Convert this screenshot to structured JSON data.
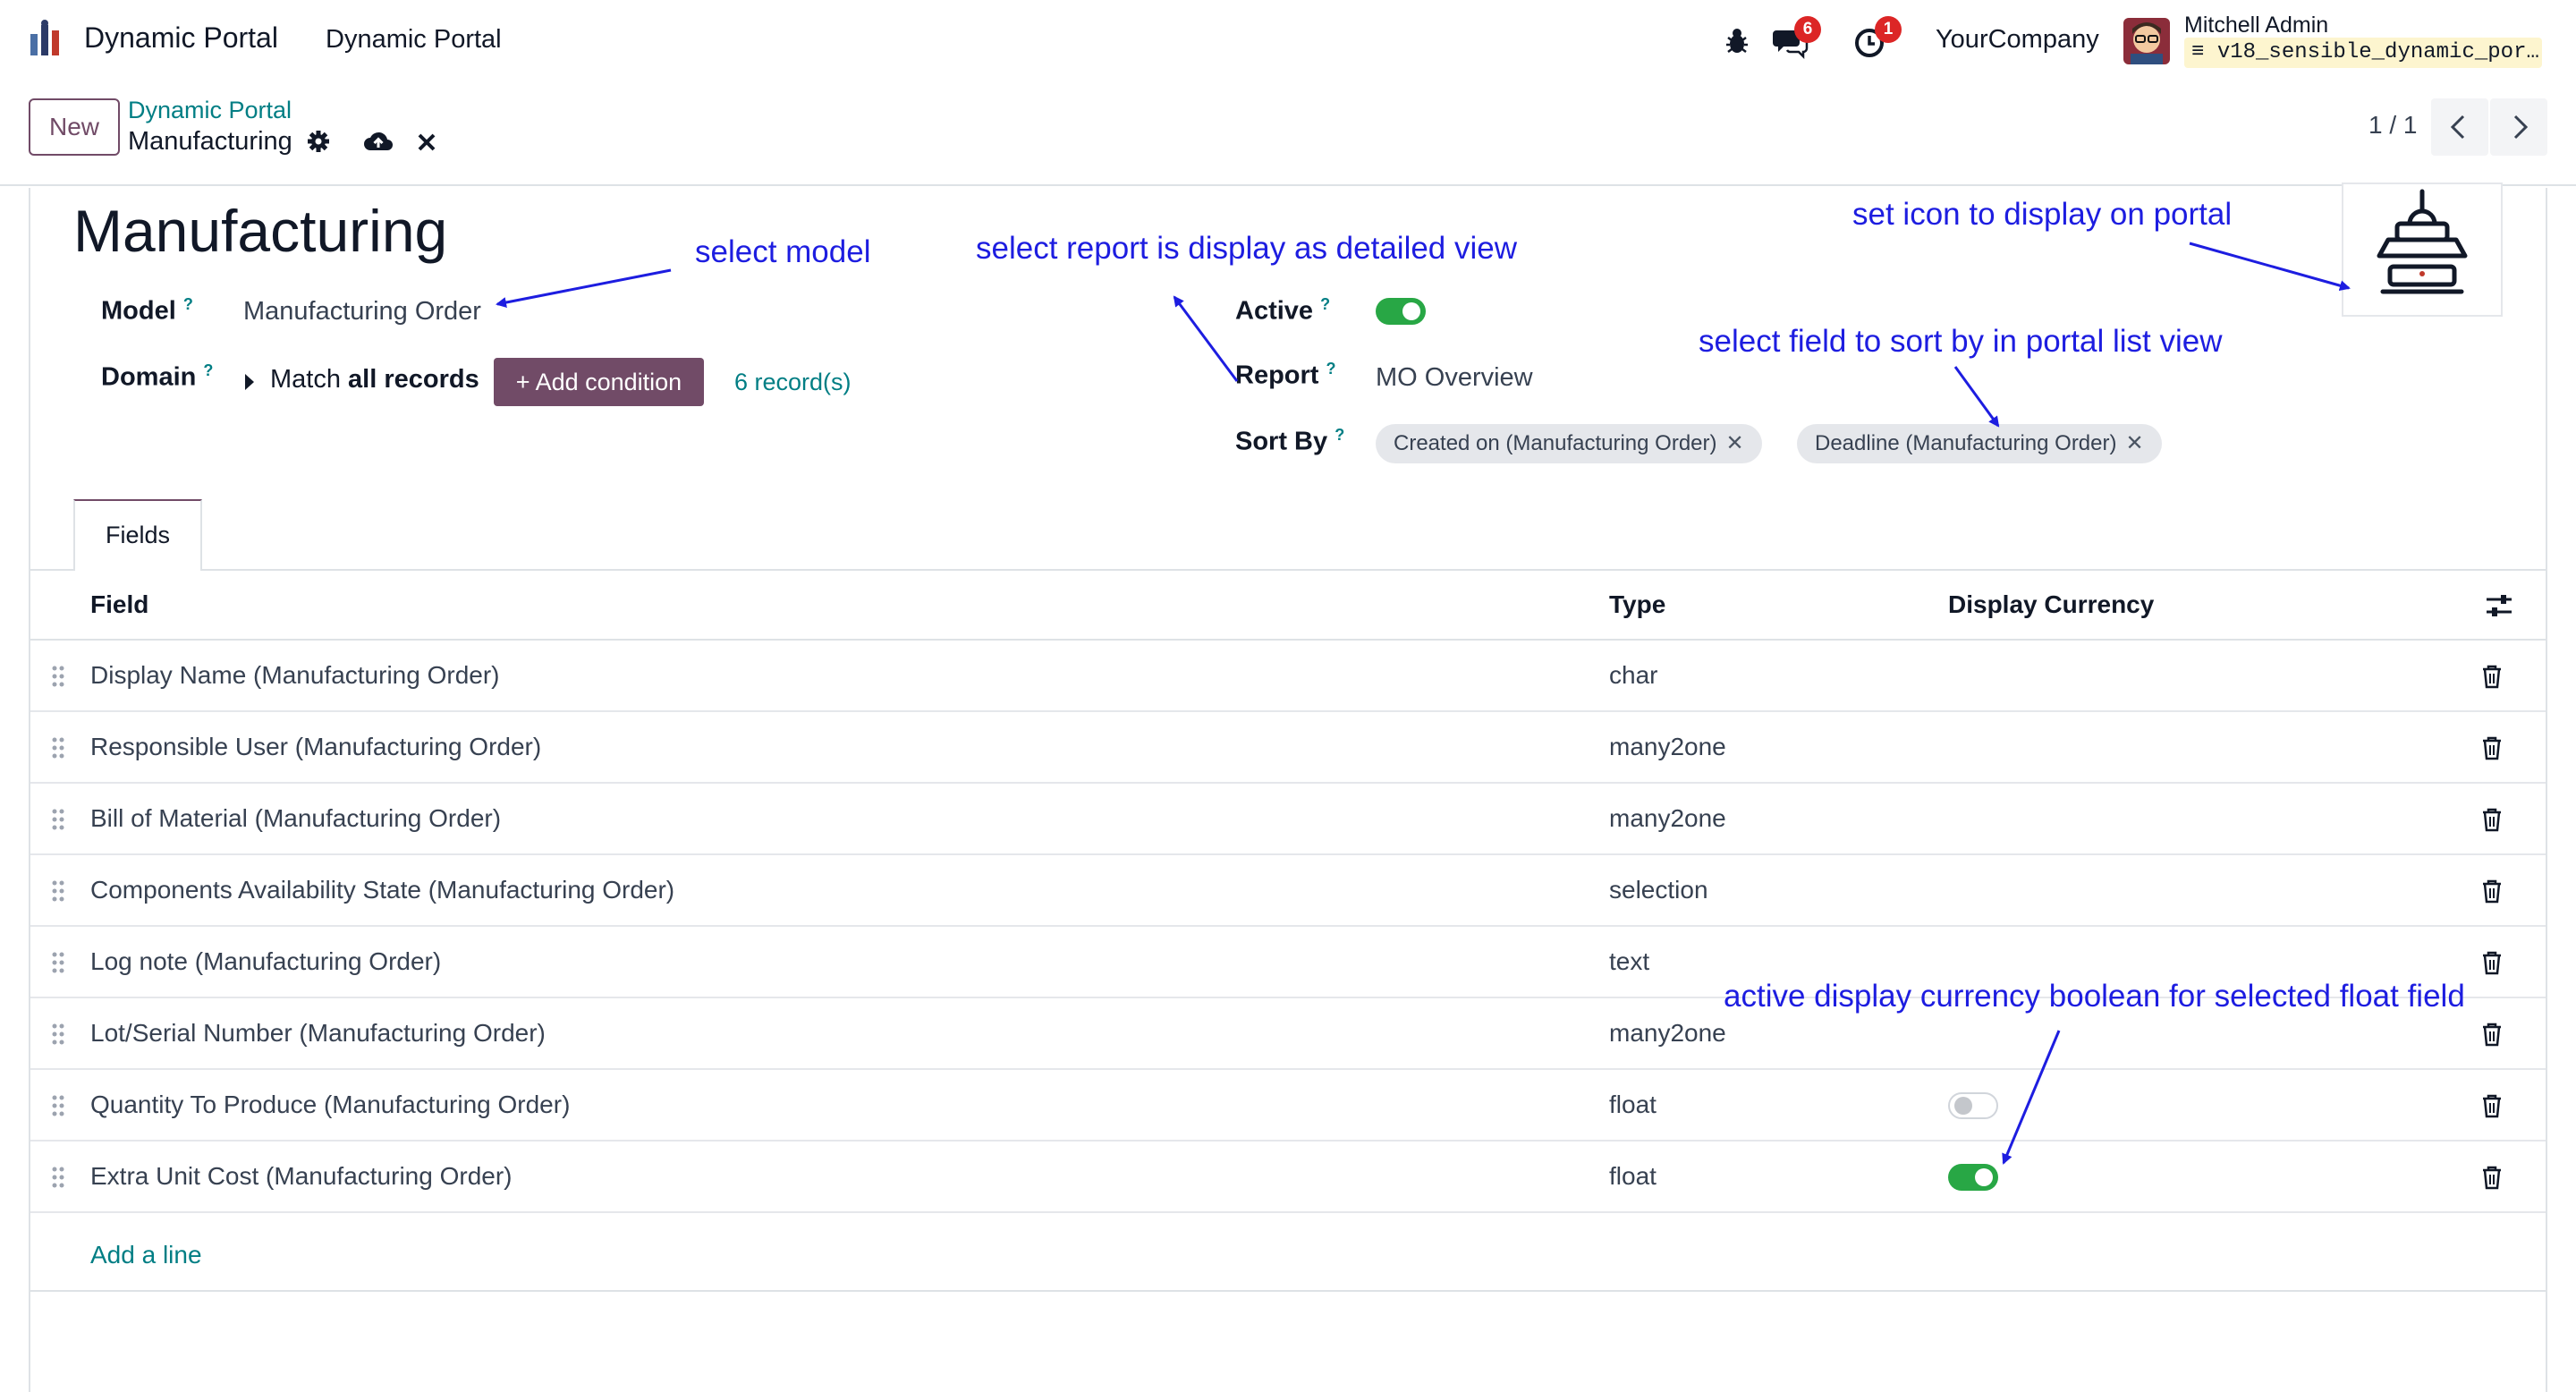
{
  "navbar": {
    "app_name": "Dynamic Portal",
    "menu_label": "Dynamic Portal",
    "messages_count": "6",
    "activities_count": "1",
    "company": "YourCompany",
    "user_name": "Mitchell Admin",
    "database": "v18_sensible_dynamic_por…"
  },
  "control_panel": {
    "new_label": "New",
    "breadcrumb_parent": "Dynamic Portal",
    "breadcrumb_current": "Manufacturing",
    "pager": "1 / 1"
  },
  "form": {
    "title": "Manufacturing",
    "model_label": "Model",
    "model_value": "Manufacturing Order",
    "domain_label": "Domain",
    "domain_match_prefix": "Match ",
    "domain_match_bold": "all records",
    "add_condition_label": "+ Add condition",
    "records_count": "6 record(s)",
    "active_label": "Active",
    "active_value": true,
    "report_label": "Report",
    "report_value": "MO Overview",
    "sort_by_label": "Sort By",
    "sort_by_tags": [
      "Created on (Manufacturing Order)",
      "Deadline (Manufacturing Order)"
    ],
    "help_mark": "?"
  },
  "tabs": [
    {
      "label": "Fields",
      "active": true
    }
  ],
  "table": {
    "headers": {
      "field": "Field",
      "type": "Type",
      "display_currency": "Display Currency"
    },
    "rows": [
      {
        "field": "Display Name (Manufacturing Order)",
        "type": "char"
      },
      {
        "field": "Responsible User (Manufacturing Order)",
        "type": "many2one"
      },
      {
        "field": "Bill of Material (Manufacturing Order)",
        "type": "many2one"
      },
      {
        "field": "Components Availability State (Manufacturing Order)",
        "type": "selection"
      },
      {
        "field": "Log note (Manufacturing Order)",
        "type": "text"
      },
      {
        "field": "Lot/Serial Number (Manufacturing Order)",
        "type": "many2one"
      },
      {
        "field": "Quantity To Produce (Manufacturing Order)",
        "type": "float",
        "display_currency": false
      },
      {
        "field": "Extra Unit Cost (Manufacturing Order)",
        "type": "float",
        "display_currency": true
      }
    ],
    "add_line_label": "Add a line"
  },
  "annotations": {
    "select_model": "select model",
    "select_report": "select report is display as detailed view",
    "set_icon": "set icon to display on portal",
    "sort_field": "select field to sort by in portal list view",
    "display_currency": "active display currency boolean for selected float field"
  },
  "colors": {
    "brand_purple": "#714b67",
    "link_teal": "#017e84",
    "toggle_green": "#28a745",
    "badge_red": "#dc2626",
    "annotation_blue": "#1d1de0"
  },
  "icons": [
    "dynamic-portal-logo-icon",
    "bug-icon",
    "chat-icon",
    "clock-icon",
    "gear-icon",
    "cloud-upload-icon",
    "discard-icon",
    "chevron-left-icon",
    "chevron-right-icon",
    "caret-right-icon",
    "settings-sliders-icon",
    "drag-handle-icon",
    "trash-icon",
    "portal-icon"
  ]
}
